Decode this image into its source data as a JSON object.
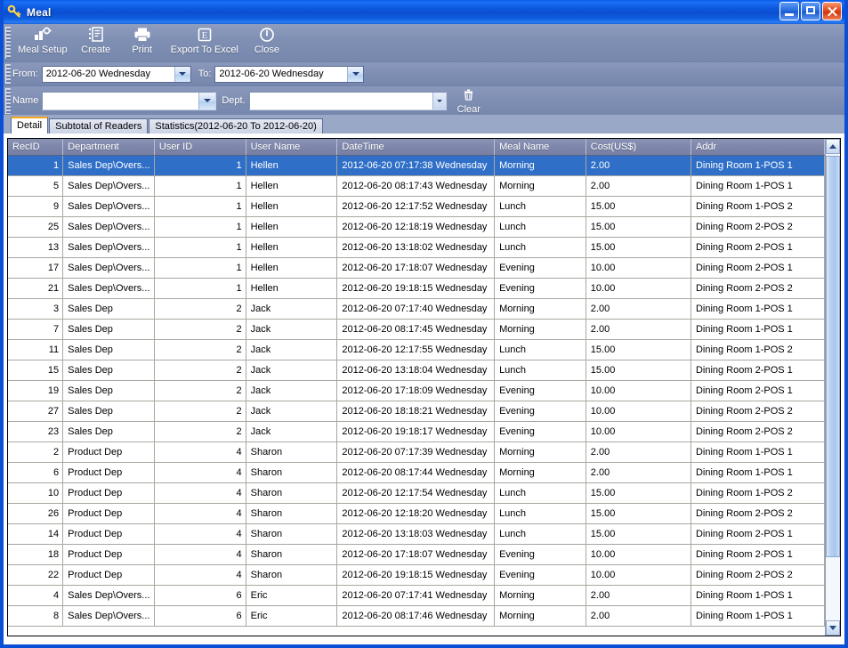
{
  "window": {
    "title": "Meal",
    "icon": "key-icon",
    "buttons": {
      "minimize": "minimize-icon",
      "maximize": "maximize-icon",
      "close": "close-icon"
    }
  },
  "toolbar": {
    "items": [
      {
        "label": "Meal Setup",
        "icon": "meal-setup-icon"
      },
      {
        "label": "Create",
        "icon": "create-icon"
      },
      {
        "label": "Print",
        "icon": "printer-icon"
      },
      {
        "label": "Export To Excel",
        "icon": "excel-icon"
      },
      {
        "label": "Close",
        "icon": "power-close-icon"
      }
    ]
  },
  "filters": {
    "from_label": "From:",
    "from_value": "2012-06-20 Wednesday",
    "to_label": "To:",
    "to_value": "2012-06-20 Wednesday",
    "name_label": "Name",
    "name_value": "",
    "name_placeholder": "",
    "dept_label": "Dept.",
    "dept_value": "",
    "dept_placeholder": "",
    "clear_label": "Clear",
    "clear_icon": "trash-icon"
  },
  "tabs": [
    {
      "label": "Detail",
      "active": true
    },
    {
      "label": "Subtotal of Readers",
      "active": false
    },
    {
      "label": "Statistics(2012-06-20 To 2012-06-20)",
      "active": false
    }
  ],
  "grid": {
    "columns": [
      "RecID",
      "Department",
      "User ID",
      "User Name",
      "DateTime",
      "Meal Name",
      "Cost(US$)",
      "Addr"
    ],
    "selected_row_index": 0,
    "rows": [
      {
        "recid": "1",
        "dept": "Sales Dep\\Overs...",
        "uid": "1",
        "uname": "Hellen",
        "datetime": "2012-06-20 07:17:38 Wednesday",
        "meal": "Morning",
        "cost": "2.00",
        "addr": "Dining Room 1-POS 1"
      },
      {
        "recid": "5",
        "dept": "Sales Dep\\Overs...",
        "uid": "1",
        "uname": "Hellen",
        "datetime": "2012-06-20 08:17:43 Wednesday",
        "meal": "Morning",
        "cost": "2.00",
        "addr": "Dining Room 1-POS 1"
      },
      {
        "recid": "9",
        "dept": "Sales Dep\\Overs...",
        "uid": "1",
        "uname": "Hellen",
        "datetime": "2012-06-20 12:17:52 Wednesday",
        "meal": "Lunch",
        "cost": "15.00",
        "addr": "Dining Room 1-POS 2"
      },
      {
        "recid": "25",
        "dept": "Sales Dep\\Overs...",
        "uid": "1",
        "uname": "Hellen",
        "datetime": "2012-06-20 12:18:19 Wednesday",
        "meal": "Lunch",
        "cost": "15.00",
        "addr": "Dining Room 2-POS 2"
      },
      {
        "recid": "13",
        "dept": "Sales Dep\\Overs...",
        "uid": "1",
        "uname": "Hellen",
        "datetime": "2012-06-20 13:18:02 Wednesday",
        "meal": "Lunch",
        "cost": "15.00",
        "addr": "Dining Room 2-POS 1"
      },
      {
        "recid": "17",
        "dept": "Sales Dep\\Overs...",
        "uid": "1",
        "uname": "Hellen",
        "datetime": "2012-06-20 17:18:07 Wednesday",
        "meal": "Evening",
        "cost": "10.00",
        "addr": "Dining Room 2-POS 1"
      },
      {
        "recid": "21",
        "dept": "Sales Dep\\Overs...",
        "uid": "1",
        "uname": "Hellen",
        "datetime": "2012-06-20 19:18:15 Wednesday",
        "meal": "Evening",
        "cost": "10.00",
        "addr": "Dining Room 2-POS 2"
      },
      {
        "recid": "3",
        "dept": "Sales Dep",
        "uid": "2",
        "uname": "Jack",
        "datetime": "2012-06-20 07:17:40 Wednesday",
        "meal": "Morning",
        "cost": "2.00",
        "addr": "Dining Room 1-POS 1"
      },
      {
        "recid": "7",
        "dept": "Sales Dep",
        "uid": "2",
        "uname": "Jack",
        "datetime": "2012-06-20 08:17:45 Wednesday",
        "meal": "Morning",
        "cost": "2.00",
        "addr": "Dining Room 1-POS 1"
      },
      {
        "recid": "11",
        "dept": "Sales Dep",
        "uid": "2",
        "uname": "Jack",
        "datetime": "2012-06-20 12:17:55 Wednesday",
        "meal": "Lunch",
        "cost": "15.00",
        "addr": "Dining Room 1-POS 2"
      },
      {
        "recid": "15",
        "dept": "Sales Dep",
        "uid": "2",
        "uname": "Jack",
        "datetime": "2012-06-20 13:18:04 Wednesday",
        "meal": "Lunch",
        "cost": "15.00",
        "addr": "Dining Room 2-POS 1"
      },
      {
        "recid": "19",
        "dept": "Sales Dep",
        "uid": "2",
        "uname": "Jack",
        "datetime": "2012-06-20 17:18:09 Wednesday",
        "meal": "Evening",
        "cost": "10.00",
        "addr": "Dining Room 2-POS 1"
      },
      {
        "recid": "27",
        "dept": "Sales Dep",
        "uid": "2",
        "uname": "Jack",
        "datetime": "2012-06-20 18:18:21 Wednesday",
        "meal": "Evening",
        "cost": "10.00",
        "addr": "Dining Room 2-POS 2"
      },
      {
        "recid": "23",
        "dept": "Sales Dep",
        "uid": "2",
        "uname": "Jack",
        "datetime": "2012-06-20 19:18:17 Wednesday",
        "meal": "Evening",
        "cost": "10.00",
        "addr": "Dining Room 2-POS 2"
      },
      {
        "recid": "2",
        "dept": "Product Dep",
        "uid": "4",
        "uname": "Sharon",
        "datetime": "2012-06-20 07:17:39 Wednesday",
        "meal": "Morning",
        "cost": "2.00",
        "addr": "Dining Room 1-POS 1"
      },
      {
        "recid": "6",
        "dept": "Product Dep",
        "uid": "4",
        "uname": "Sharon",
        "datetime": "2012-06-20 08:17:44 Wednesday",
        "meal": "Morning",
        "cost": "2.00",
        "addr": "Dining Room 1-POS 1"
      },
      {
        "recid": "10",
        "dept": "Product Dep",
        "uid": "4",
        "uname": "Sharon",
        "datetime": "2012-06-20 12:17:54 Wednesday",
        "meal": "Lunch",
        "cost": "15.00",
        "addr": "Dining Room 1-POS 2"
      },
      {
        "recid": "26",
        "dept": "Product Dep",
        "uid": "4",
        "uname": "Sharon",
        "datetime": "2012-06-20 12:18:20 Wednesday",
        "meal": "Lunch",
        "cost": "15.00",
        "addr": "Dining Room 2-POS 2"
      },
      {
        "recid": "14",
        "dept": "Product Dep",
        "uid": "4",
        "uname": "Sharon",
        "datetime": "2012-06-20 13:18:03 Wednesday",
        "meal": "Lunch",
        "cost": "15.00",
        "addr": "Dining Room 2-POS 1"
      },
      {
        "recid": "18",
        "dept": "Product Dep",
        "uid": "4",
        "uname": "Sharon",
        "datetime": "2012-06-20 17:18:07 Wednesday",
        "meal": "Evening",
        "cost": "10.00",
        "addr": "Dining Room 2-POS 1"
      },
      {
        "recid": "22",
        "dept": "Product Dep",
        "uid": "4",
        "uname": "Sharon",
        "datetime": "2012-06-20 19:18:15 Wednesday",
        "meal": "Evening",
        "cost": "10.00",
        "addr": "Dining Room 2-POS 2"
      },
      {
        "recid": "4",
        "dept": "Sales Dep\\Overs...",
        "uid": "6",
        "uname": "Eric",
        "datetime": "2012-06-20 07:17:41 Wednesday",
        "meal": "Morning",
        "cost": "2.00",
        "addr": "Dining Room 1-POS 1"
      },
      {
        "recid": "8",
        "dept": "Sales Dep\\Overs...",
        "uid": "6",
        "uname": "Eric",
        "datetime": "2012-06-20 08:17:46 Wednesday",
        "meal": "Morning",
        "cost": "2.00",
        "addr": "Dining Room 1-POS 1"
      }
    ]
  },
  "colors": {
    "title_blue": "#0a4fd6",
    "toolbar_gray": "#7f8fb3",
    "selection_blue": "#2f6fc8",
    "tab_accent": "#f5a623",
    "header_gray": "#7e87ab"
  }
}
